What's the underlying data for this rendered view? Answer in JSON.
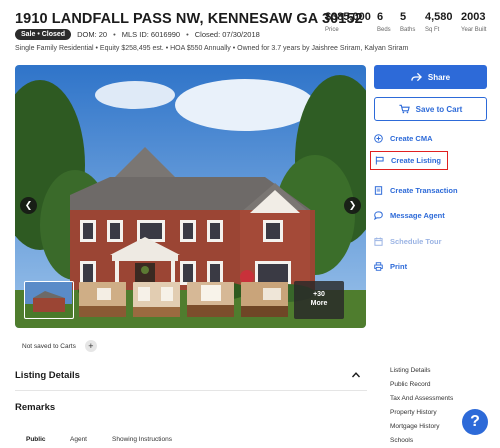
{
  "listing": {
    "address": "1910 LANDFALL PASS NW, KENNESAW GA 30152",
    "status_badge": "Sale • Closed",
    "dom": "DOM: 20",
    "mls": "MLS ID: 6016990",
    "closed": "Closed: 07/30/2018",
    "subline": "Single Family Residential • Equity $258,495 est. • HOA $550 Annually • Owned for 3.7 years by Jaishree Sriram, Kalyan Sriram"
  },
  "stats": [
    {
      "value": "$385,000",
      "label": "Price"
    },
    {
      "value": "6",
      "label": "Beds"
    },
    {
      "value": "5",
      "label": "Baths"
    },
    {
      "value": "4,580",
      "label": "Sq Ft"
    },
    {
      "value": "2003",
      "label": "Year Built"
    }
  ],
  "gallery": {
    "more_count": "+30",
    "more_label": "More"
  },
  "actions": {
    "share": "Share",
    "save_to_cart": "Save to Cart",
    "create_cma": "Create CMA",
    "create_listing": "Create Listing",
    "create_transaction": "Create Transaction",
    "message_agent": "Message Agent",
    "schedule_tour": "Schedule Tour",
    "print": "Print"
  },
  "carts": {
    "status": "Not saved to Carts"
  },
  "sections": {
    "listing_details": "Listing Details",
    "remarks": "Remarks"
  },
  "remarks_tabs": [
    "Public",
    "Agent",
    "Showing Instructions"
  ],
  "side_nav": [
    "Listing Details",
    "Public Record",
    "Tax And Assessments",
    "Property History",
    "Mortgage History",
    "Schools"
  ],
  "help": {
    "label": "?"
  },
  "colors": {
    "accent": "#2d6ad8",
    "highlight_border": "#e02020",
    "badge_bg": "#2b2b2b"
  }
}
